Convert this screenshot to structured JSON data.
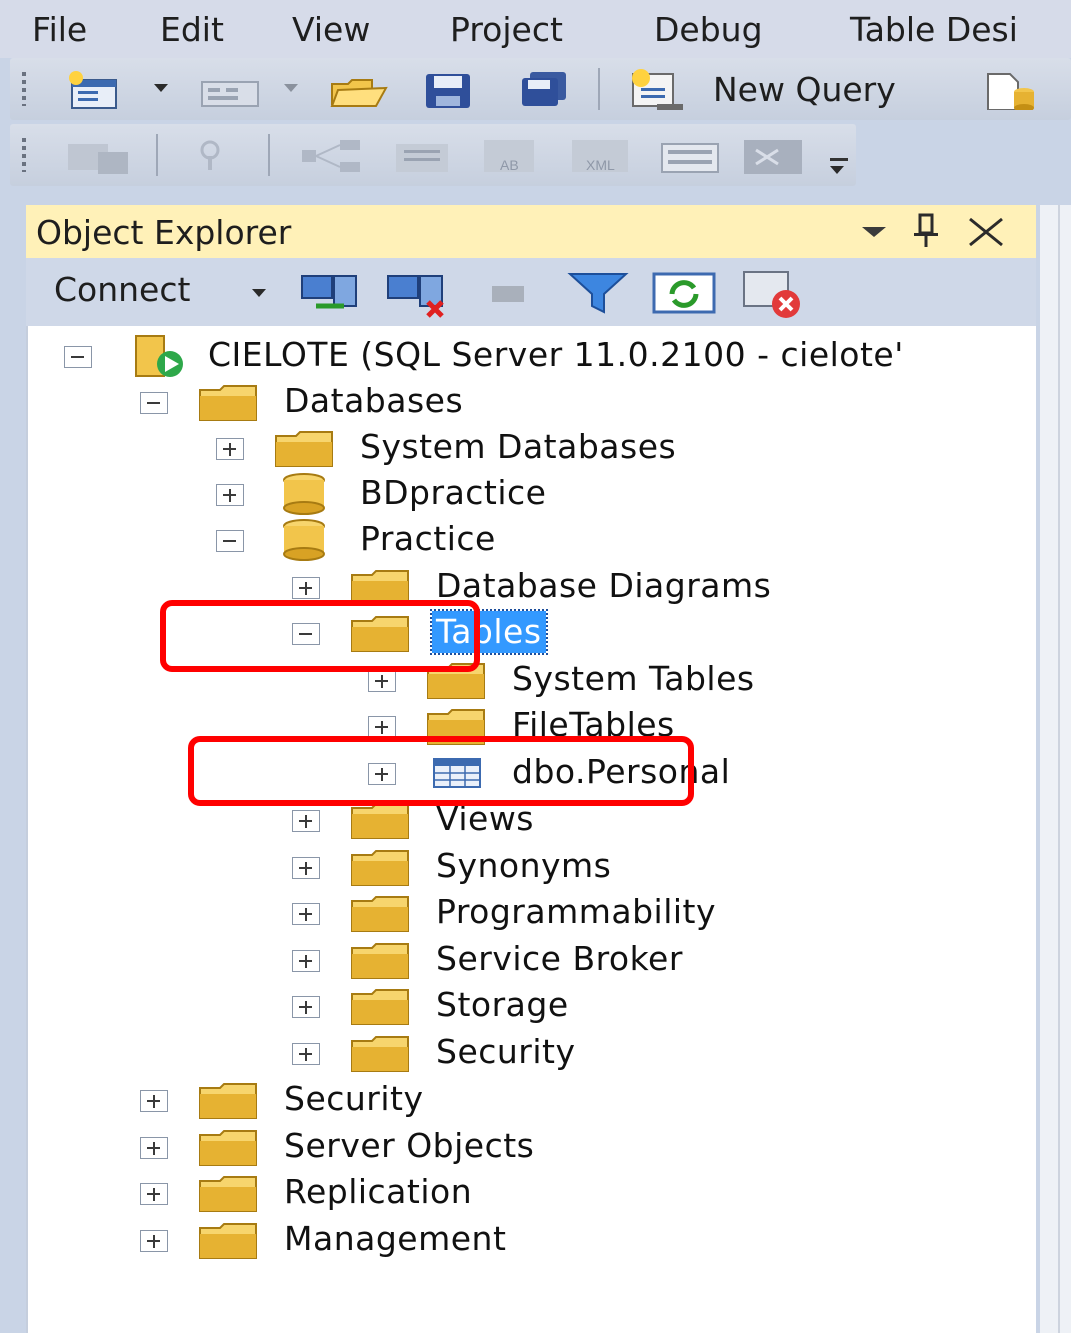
{
  "menubar": {
    "items": [
      "File",
      "Edit",
      "View",
      "Project",
      "Debug",
      "Table Desi"
    ]
  },
  "toolbar": {
    "new_query_label": "New Query"
  },
  "object_explorer": {
    "title": "Object Explorer",
    "connect_label": "Connect",
    "tree": {
      "server": "CIELOTE (SQL Server 11.0.2100 - cielote'",
      "databases": "Databases",
      "system_databases": "System Databases",
      "bdpractice": "BDpractice",
      "practice": "Practice",
      "database_diagrams": "Database Diagrams",
      "tables": "Tables",
      "system_tables": "System Tables",
      "filetables": "FileTables",
      "dbo_personal": "dbo.Personal",
      "views": "Views",
      "synonyms": "Synonyms",
      "programmability": "Programmability",
      "service_broker": "Service Broker",
      "storage": "Storage",
      "db_security": "Security",
      "security": "Security",
      "server_objects": "Server Objects",
      "replication": "Replication",
      "management": "Management"
    }
  },
  "colors": {
    "selection": "#3399ff",
    "highlight_box": "#ff0000",
    "title_bar": "#fff1b8"
  }
}
